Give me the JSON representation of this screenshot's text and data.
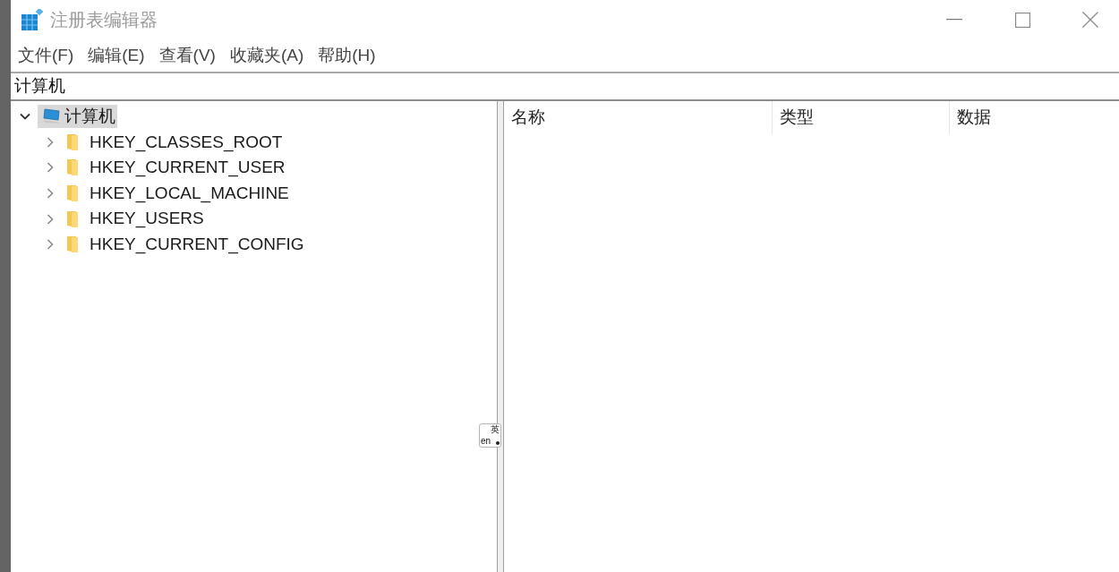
{
  "window": {
    "title": "注册表编辑器"
  },
  "menu": [
    {
      "label": "文件(F)"
    },
    {
      "label": "编辑(E)"
    },
    {
      "label": "查看(V)"
    },
    {
      "label": "收藏夹(A)"
    },
    {
      "label": "帮助(H)"
    }
  ],
  "address_bar": {
    "value": "计算机"
  },
  "tree": [
    {
      "label": "计算机",
      "kind": "computer",
      "expanded": true,
      "selected": true,
      "children": [
        {
          "label": "HKEY_CLASSES_ROOT",
          "kind": "folder",
          "expanded": false,
          "selected": false
        },
        {
          "label": "HKEY_CURRENT_USER",
          "kind": "folder",
          "expanded": false,
          "selected": false
        },
        {
          "label": "HKEY_LOCAL_MACHINE",
          "kind": "folder",
          "expanded": false,
          "selected": false
        },
        {
          "label": "HKEY_USERS",
          "kind": "folder",
          "expanded": false,
          "selected": false
        },
        {
          "label": "HKEY_CURRENT_CONFIG",
          "kind": "folder",
          "expanded": false,
          "selected": false
        }
      ]
    }
  ],
  "list": {
    "columns": [
      "名称",
      "类型",
      "数据"
    ]
  },
  "ime_indicator": {
    "mode": "en",
    "language": "英"
  }
}
